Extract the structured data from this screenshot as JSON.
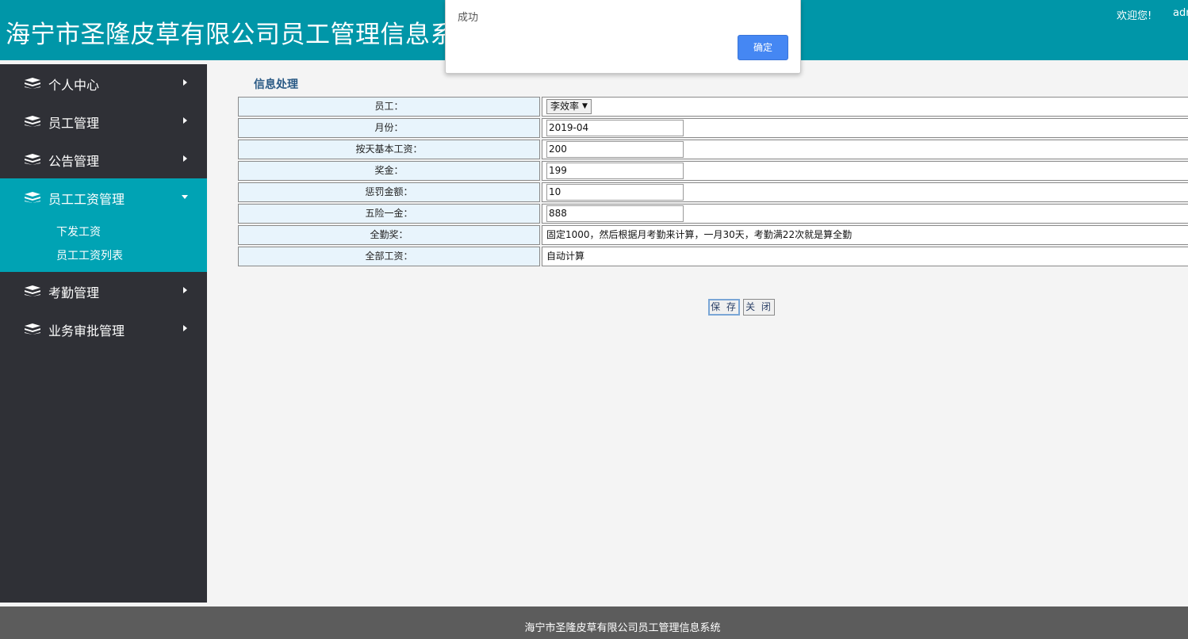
{
  "header": {
    "title": "海宁市圣隆皮草有限公司员工管理信息系统",
    "welcome": "欢迎您!",
    "username": "admin"
  },
  "sidebar": {
    "items": [
      {
        "label": "个人中心",
        "icon": "layers-icon",
        "caret": "right"
      },
      {
        "label": "员工管理",
        "icon": "layers-icon",
        "caret": "right"
      },
      {
        "label": "公告管理",
        "icon": "layers-icon",
        "caret": "right"
      },
      {
        "label": "员工工资管理",
        "icon": "layers-icon",
        "caret": "down",
        "active": true
      },
      {
        "label": "考勤管理",
        "icon": "layers-icon",
        "caret": "right"
      },
      {
        "label": "业务审批管理",
        "icon": "layers-icon",
        "caret": "right"
      }
    ],
    "submenu": [
      "下发工资",
      "员工工资列表"
    ]
  },
  "form": {
    "title": "信息处理",
    "rows": [
      {
        "label": "员工：",
        "type": "select",
        "value": "李效率"
      },
      {
        "label": "月份：",
        "type": "input",
        "value": "2019-04"
      },
      {
        "label": "按天基本工资：",
        "type": "input",
        "value": "200"
      },
      {
        "label": "奖金：",
        "type": "input",
        "value": "199"
      },
      {
        "label": "惩罚金额：",
        "type": "input",
        "value": "10"
      },
      {
        "label": "五险一金：",
        "type": "input",
        "value": "888"
      },
      {
        "label": "全勤奖：",
        "type": "text",
        "value": "固定1000，然后根据月考勤来计算，一月30天，考勤满22次就是算全勤"
      },
      {
        "label": "全部工资：",
        "type": "text",
        "value": "自动计算"
      }
    ],
    "save_label": "保 存",
    "close_label": "关 闭"
  },
  "dialog": {
    "message": "成功",
    "ok_label": "确定"
  },
  "footer": {
    "text": "海宁市圣隆皮草有限公司员工管理信息系统"
  },
  "colors": {
    "header": "#0096a8",
    "sidebar": "#2f3036",
    "active": "#00a3b4",
    "dialog_button": "#4587f3",
    "footer": "#5c5c5c"
  }
}
